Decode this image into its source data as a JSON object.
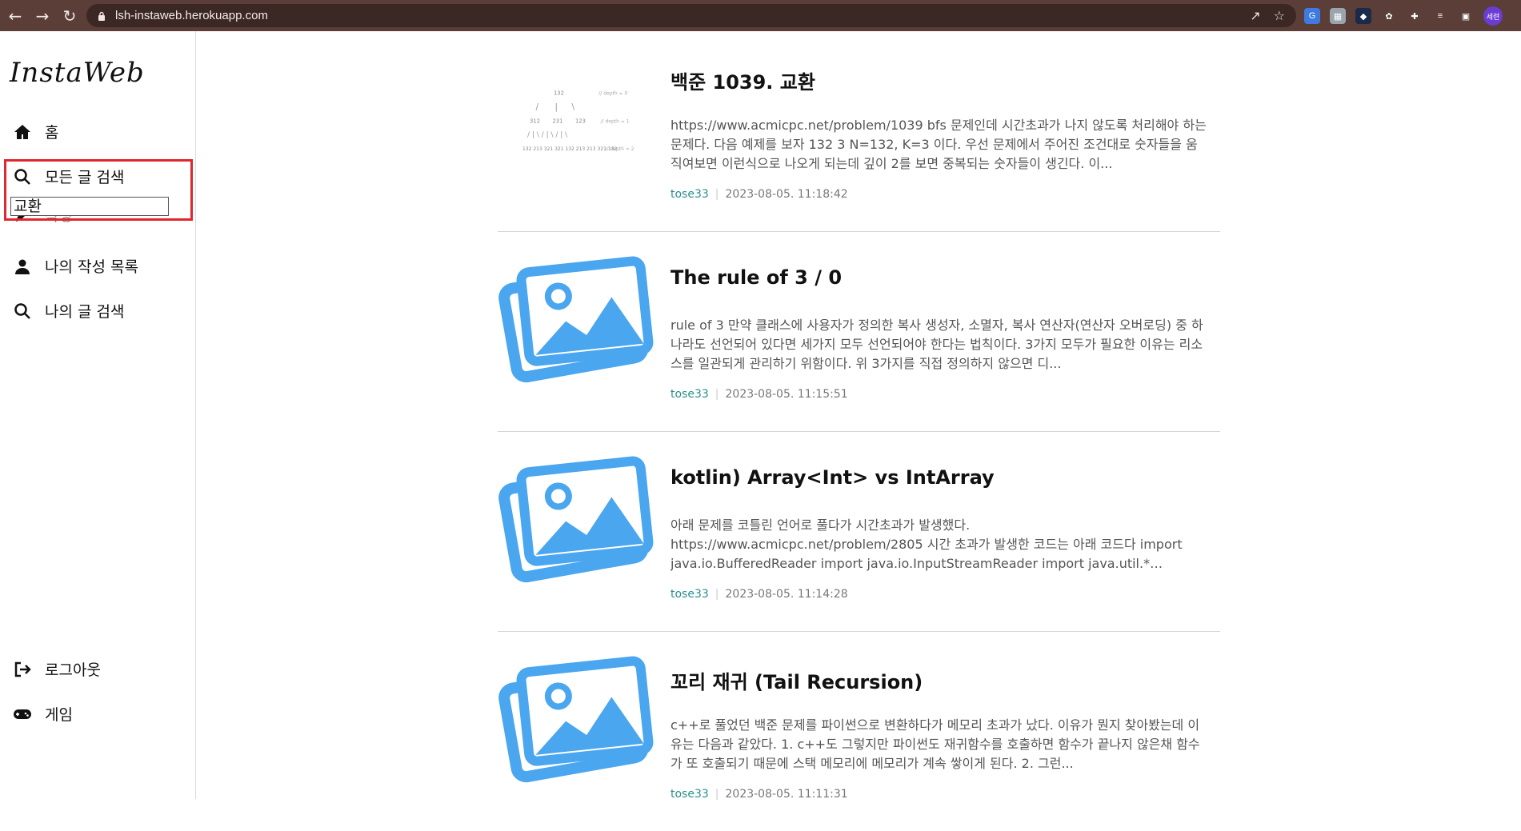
{
  "browser": {
    "url": "lsh-instaweb.herokuapp.com",
    "profile_label": "세련"
  },
  "sidebar": {
    "logo": "InstaWeb",
    "items": [
      {
        "label": "홈",
        "icon": "home-icon"
      },
      {
        "label": "모든 글 검색",
        "icon": "search-icon"
      },
      {
        "label": "작성",
        "icon": "pen-icon"
      },
      {
        "label": "나의 작성 목록",
        "icon": "person-icon"
      },
      {
        "label": "나의 글 검색",
        "icon": "search-icon"
      },
      {
        "label": "로그아웃",
        "icon": "logout-icon"
      },
      {
        "label": "게임",
        "icon": "gamepad-icon"
      }
    ],
    "search_value": "교환"
  },
  "posts": [
    {
      "title": "백준 1039. 교환",
      "body": "https://www.acmicpc.net/problem/1039 bfs 문제인데 시간초과가 나지 않도록 처리해야 하는 문제다. 다음 예제를 보자    132 3 N=132, K=3 이다. 우선 문제에서 주어진 조건대로 숫자들을 움직여보면    이런식으로 나오게 되는데 깊이 2를 보면 중복되는 숫자들이 생긴다.  이...",
      "author": "tose33",
      "date": "2023-08-05. 11:18:42",
      "thumb": "tree-diagram",
      "thumb_text": {
        "root": "132",
        "mid": [
          "312",
          "231",
          "123"
        ],
        "leaf": "132 213 321  321 132 213  213 321 132",
        "d0": "// depth = 0",
        "d1": "// depth = 1",
        "d2": "// depth = 2"
      }
    },
    {
      "title": "The rule of 3 / 0",
      "body": "rule of 3 만약 클래스에 사용자가 정의한 복사 생성자, 소멸자, 복사 연산자(연산자 오버로딩) 중 하나라도 선언되어 있다면 세가지 모두 선언되어야 한다는 법칙이다. 3가지 모두가 필요한 이유는 리소스를 일관되게 관리하기 위함이다.   위 3가지를 직접 정의하지 않으면 디...",
      "author": "tose33",
      "date": "2023-08-05. 11:15:51",
      "thumb": "image-placeholder"
    },
    {
      "title": "kotlin) Array<Int> vs IntArray",
      "body": "아래 문제를 코틀린 언어로 풀다가 시간초과가 발생했다. https://www.acmicpc.net/problem/2805 시간 초과가 발생한 코드는 아래 코드다  import java.io.BufferedReader import java.io.InputStreamReader import java.util.* import...",
      "author": "tose33",
      "date": "2023-08-05. 11:14:28",
      "thumb": "image-placeholder"
    },
    {
      "title": "꼬리 재귀 (Tail Recursion)",
      "body": "c++로 풀었던 백준 문제를 파이썬으로 변환하다가 메모리 초과가 났다. 이유가 뭔지 찾아봤는데 이유는 다음과 같았다.   1. c++도 그렇지만 파이썬도 재귀함수를 호출하면 함수가 끝나지 않은채 함수가 또 호출되기 때문에 스택 메모리에 메모리가 계속 쌓이게 된다.   2. 그런...",
      "author": "tose33",
      "date": "2023-08-05. 11:11:31",
      "thumb": "image-placeholder"
    }
  ],
  "colors": {
    "chrome": "#5a3e37",
    "placeholder": "#4aa6ef",
    "highlight": "#e0262e"
  }
}
